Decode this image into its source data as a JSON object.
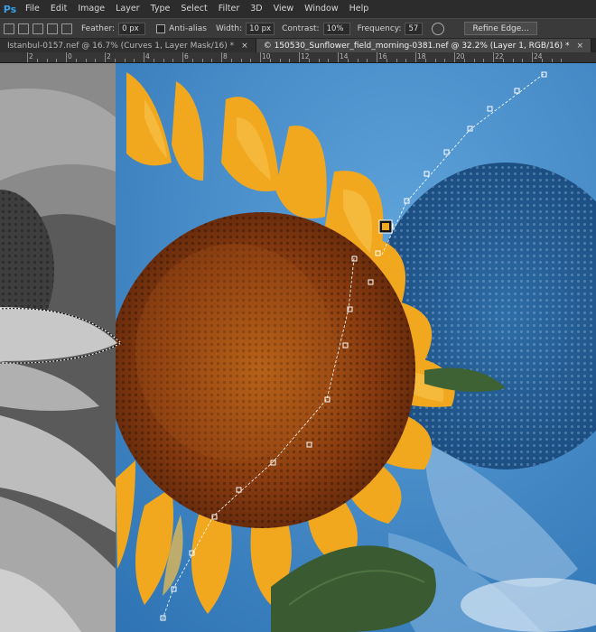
{
  "app": {
    "logo": "Ps"
  },
  "menu": [
    "File",
    "Edit",
    "Image",
    "Layer",
    "Type",
    "Select",
    "Filter",
    "3D",
    "View",
    "Window",
    "Help"
  ],
  "options": {
    "feather_label": "Feather:",
    "feather_value": "0 px",
    "antialias_label": "Anti-alias",
    "width_label": "Width:",
    "width_value": "10 px",
    "contrast_label": "Contrast:",
    "contrast_value": "10%",
    "frequency_label": "Frequency:",
    "frequency_value": "57",
    "refine_edge_label": "Refine Edge..."
  },
  "tabs": [
    {
      "title": "Istanbul-0157.nef @ 16.7% (Curves 1, Layer Mask/16) *",
      "active": false
    },
    {
      "title": "© 150530_Sunflower_field_morning-0381.nef @ 32.2% (Layer 1, RGB/16) *",
      "active": true
    }
  ],
  "ruler": {
    "labels": [
      "2",
      "0",
      "2",
      "4",
      "6",
      "8",
      "10",
      "12",
      "14",
      "16",
      "18",
      "20",
      "22",
      "24"
    ]
  },
  "colors": {
    "sky": "#3a84c4",
    "petal": "#f0a520",
    "disk": "#9a4a12",
    "leaf": "#3a5a32"
  }
}
